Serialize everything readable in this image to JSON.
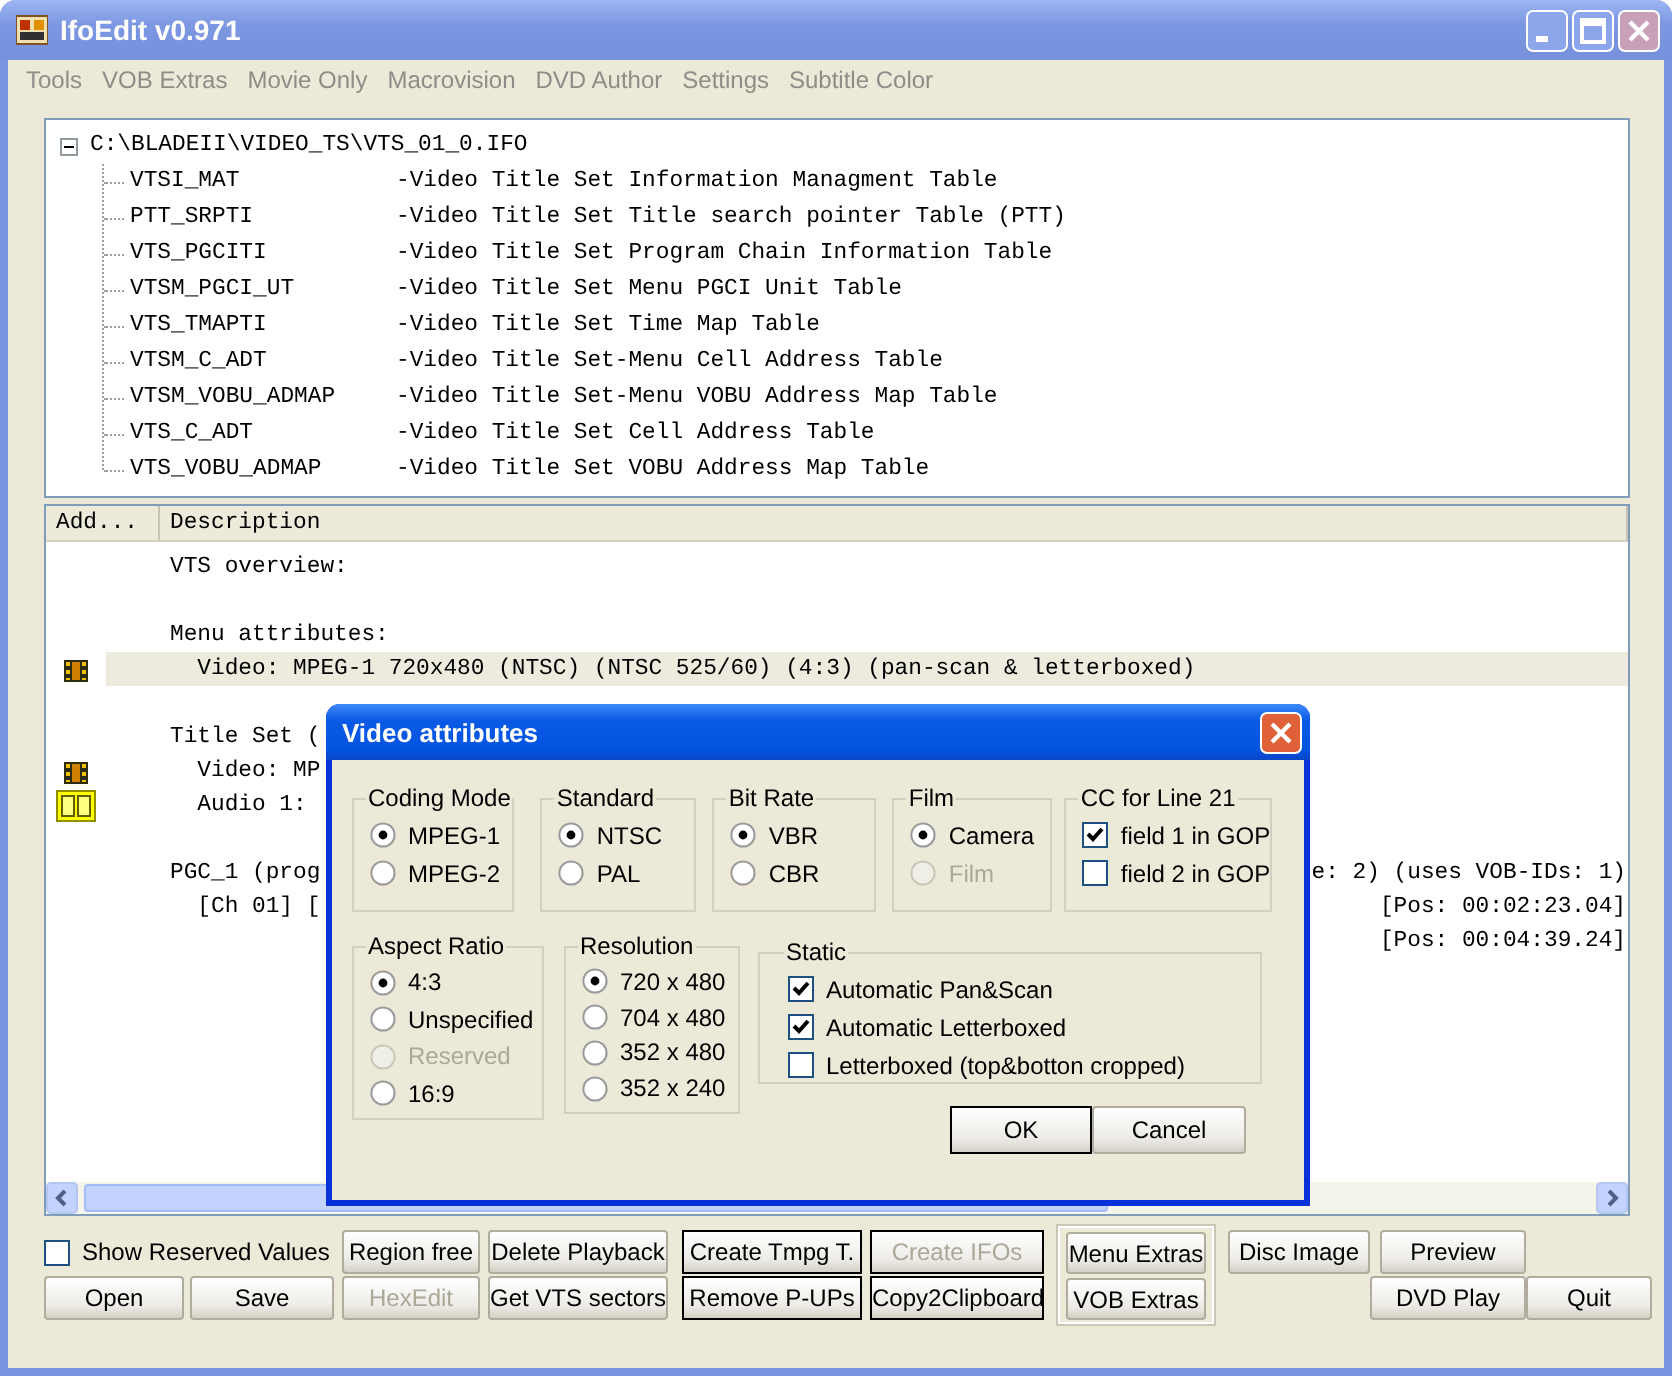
{
  "window": {
    "title": "IfoEdit v0.971"
  },
  "menu": [
    {
      "label": "Tools",
      "disabled": true
    },
    {
      "label": "VOB Extras",
      "disabled": true
    },
    {
      "label": "Movie Only",
      "disabled": true
    },
    {
      "label": "Macrovision",
      "disabled": true
    },
    {
      "label": "DVD Author",
      "disabled": true
    },
    {
      "label": "Settings",
      "disabled": true
    },
    {
      "label": "Subtitle Color",
      "disabled": true
    }
  ],
  "tree": {
    "root": {
      "label": "C:\\BLADEII\\VIDEO_TS\\VTS_01_0.IFO",
      "expanded": true,
      "children": [
        {
          "name": "VTSI_MAT",
          "description": "-Video Title Set Information Managment Table"
        },
        {
          "name": "PTT_SRPTI",
          "description": "-Video Title Set Title search pointer Table (PTT)"
        },
        {
          "name": "VTS_PGCITI",
          "description": "-Video Title Set Program Chain Information Table"
        },
        {
          "name": "VTSM_PGCI_UT",
          "description": "-Video Title Set Menu PGCI Unit Table"
        },
        {
          "name": "VTS_TMAPTI",
          "description": "-Video Title Set Time Map Table"
        },
        {
          "name": "VTSM_C_ADT",
          "description": "-Video Title Set-Menu Cell Address Table"
        },
        {
          "name": "VTSM_VOBU_ADMAP",
          "description": "-Video Title Set-Menu VOBU Address Map Table"
        },
        {
          "name": "VTS_C_ADT",
          "description": "-Video Title Set Cell Address Table"
        },
        {
          "name": "VTS_VOBU_ADMAP",
          "description": "-Video Title Set VOBU Address Map Table"
        }
      ]
    }
  },
  "list": {
    "columns": [
      "Add...",
      "Description"
    ],
    "rows": [
      {
        "kind": "text",
        "selected": false,
        "text": "VTS overview:"
      },
      {
        "kind": "blank",
        "selected": false
      },
      {
        "kind": "text",
        "selected": false,
        "text": "Menu attributes:"
      },
      {
        "kind": "video",
        "selected": true,
        "text": "  Video: MPEG-1 720x480 (NTSC) (NTSC 525/60) (4:3) (pan-scan & letterboxed)"
      },
      {
        "kind": "blank",
        "selected": false
      },
      {
        "kind": "text",
        "selected": false,
        "text": "Title Set ("
      },
      {
        "kind": "video",
        "selected": false,
        "text": "  Video: MP"
      },
      {
        "kind": "audio",
        "selected": false,
        "text": "  Audio 1:"
      },
      {
        "kind": "blank",
        "selected": false
      },
      {
        "kind": "text",
        "selected": false,
        "text": "PGC_1 (prog",
        "text_right": "e: 2) (uses VOB-IDs: 1)"
      },
      {
        "kind": "text",
        "selected": false,
        "text": "  [Ch 01] [",
        "text_right": "[Pos: 00:02:23.04]"
      },
      {
        "kind": "text",
        "selected": false,
        "text_right": "[Pos: 00:04:39.24]"
      }
    ]
  },
  "controls": {
    "show_reserved_values": {
      "label": "Show Reserved Values",
      "checked": false
    },
    "buttons": [
      {
        "label": "Region free",
        "kind": "push",
        "disabled": false
      },
      {
        "label": "Delete Playback",
        "kind": "push",
        "disabled": false
      },
      {
        "label": "Create Tmpg T.",
        "kind": "framed",
        "disabled": false
      },
      {
        "label": "Create IFOs",
        "kind": "framed",
        "disabled": true
      },
      {
        "label": "Menu Extras",
        "kind": "grouped",
        "disabled": false
      },
      {
        "label": "Disc Image",
        "kind": "push",
        "disabled": false
      },
      {
        "label": "Preview",
        "kind": "push",
        "disabled": false
      },
      {
        "label": "Open",
        "kind": "push",
        "disabled": false
      },
      {
        "label": "Save",
        "kind": "push",
        "disabled": false
      },
      {
        "label": "HexEdit",
        "kind": "push",
        "disabled": true
      },
      {
        "label": "Get VTS sectors",
        "kind": "push",
        "disabled": false
      },
      {
        "label": "Remove P-UPs",
        "kind": "framed",
        "disabled": false
      },
      {
        "label": "Copy2Clipboard",
        "kind": "framed",
        "disabled": false
      },
      {
        "label": "VOB Extras",
        "kind": "grouped",
        "disabled": false
      },
      {
        "label": "DVD Play",
        "kind": "push",
        "disabled": false
      },
      {
        "label": "Quit",
        "kind": "push",
        "disabled": false
      }
    ]
  },
  "dialog": {
    "title": "Video attributes",
    "groups": [
      {
        "title": "Coding Mode",
        "kind": "radio",
        "options": [
          {
            "label": "MPEG-1",
            "selected": true,
            "disabled": false
          },
          {
            "label": "MPEG-2",
            "selected": false,
            "disabled": false
          }
        ]
      },
      {
        "title": "Standard",
        "kind": "radio",
        "options": [
          {
            "label": "NTSC",
            "selected": true,
            "disabled": false
          },
          {
            "label": "PAL",
            "selected": false,
            "disabled": false
          }
        ]
      },
      {
        "title": "Bit Rate",
        "kind": "radio",
        "options": [
          {
            "label": "VBR",
            "selected": true,
            "disabled": false
          },
          {
            "label": "CBR",
            "selected": false,
            "disabled": false
          }
        ]
      },
      {
        "title": "Film",
        "kind": "radio",
        "options": [
          {
            "label": "Camera",
            "selected": true,
            "disabled": false
          },
          {
            "label": "Film",
            "selected": false,
            "disabled": true
          }
        ]
      },
      {
        "title": "CC for Line 21",
        "kind": "check",
        "options": [
          {
            "label": "field 1 in GOP",
            "checked": true,
            "disabled": false
          },
          {
            "label": "field 2 in GOP",
            "checked": false,
            "disabled": false
          }
        ]
      },
      {
        "title": "Aspect Ratio",
        "kind": "radio",
        "options": [
          {
            "label": "4:3",
            "selected": true,
            "disabled": false
          },
          {
            "label": "Unspecified",
            "selected": false,
            "disabled": false
          },
          {
            "label": "Reserved",
            "selected": false,
            "disabled": true
          },
          {
            "label": "16:9",
            "selected": false,
            "disabled": false
          }
        ]
      },
      {
        "title": "Resolution",
        "kind": "radio",
        "options": [
          {
            "label": "720 x 480",
            "selected": true,
            "disabled": false
          },
          {
            "label": "704 x 480",
            "selected": false,
            "disabled": false
          },
          {
            "label": "352 x 480",
            "selected": false,
            "disabled": false
          },
          {
            "label": "352 x 240",
            "selected": false,
            "disabled": false
          }
        ]
      },
      {
        "title": "Static",
        "kind": "check",
        "options": [
          {
            "label": "Automatic Pan&Scan",
            "checked": true,
            "disabled": false
          },
          {
            "label": "Automatic Letterboxed",
            "checked": true,
            "disabled": false
          },
          {
            "label": "Letterboxed (top&botton cropped)",
            "checked": false,
            "disabled": false
          }
        ]
      }
    ],
    "buttons": [
      {
        "label": "OK",
        "default": true
      },
      {
        "label": "Cancel",
        "default": false
      }
    ]
  }
}
